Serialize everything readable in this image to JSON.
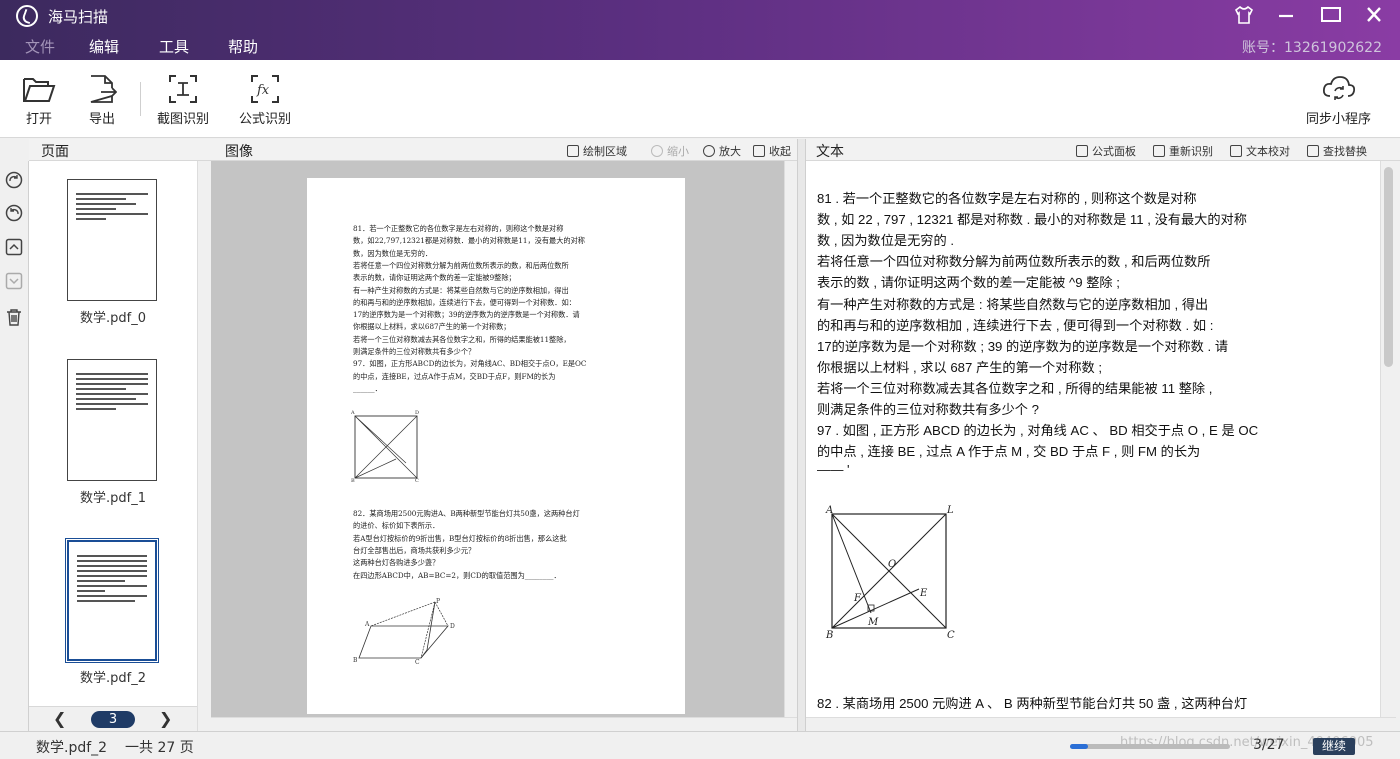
{
  "app": {
    "title": "海马扫描",
    "account": "账号：13261902622"
  },
  "menu": [
    "文件",
    "编辑",
    "工具",
    "帮助"
  ],
  "toolbar": {
    "open": "打开",
    "export": "导出",
    "screenshot_ocr": "截图识别",
    "formula_ocr": "公式识别",
    "sync": "同步小程序"
  },
  "pages_panel": {
    "title": "页面",
    "thumbnails": [
      "数学.pdf_0",
      "数学.pdf_1",
      "数学.pdf_2"
    ],
    "current_page": "3",
    "selected_index": 2
  },
  "image_panel": {
    "title": "图像",
    "actions": [
      "绘制区域",
      "缩小",
      "放大",
      "收起"
    ],
    "doc_lines": [
      "81．若一个正整数它的各位数字是左右对称的，则称这个数是对称",
      "数，如22,797,12321都是对称数．最小的对称数是11，没有最大的对称",
      "数，因为数位是无穷的．",
      "若将任意一个四位对称数分解为前两位数所表示的数，和后两位数所",
      "表示的数，请你证明这两个数的差一定能被9整除；",
      "有一种产生对称数的方式是：将某些自然数与它的逆序数相加，得出",
      "的和再与和的逆序数相加，连续进行下去，便可得到一个对称数．如：",
      "17的逆序数为是一个对称数；39的逆序数为的逆序数是一个对称数．请",
      "你根据以上材料，求以687产生的第一个对称数；",
      "若将一个三位对称数减去其各位数字之和，所得的结果能被11整除，",
      "则满足条件的三位对称数共有多少个？",
      "97．如图，正方形ABCD的边长为，对角线AC、BD相交于点O，E是OC",
      "的中点，连接BE，过点A作于点M，交BD于点F，则FM的长为",
      "______．"
    ],
    "doc_lines_b": [
      "82．某商场用2500元购进A、B两种新型节能台灯共50盏，这两种台灯",
      "的进价、标价如下表所示．",
      "若A型台灯按标价的9折出售，B型台灯按标价的8折出售，那么这批",
      "台灯全部售出后，商场共获利多少元？",
      "这两种台灯各购进多少盏？",
      "在四边形ABCD中，AB=BC=2，则CD的取值范围为________．"
    ],
    "fig_labels": [
      "A",
      "D",
      "O",
      "F",
      "E",
      "M",
      "B",
      "C"
    ],
    "fig2_labels": [
      "P",
      "A",
      "F",
      "D",
      "B",
      "C",
      "E"
    ]
  },
  "text_panel": {
    "title": "文本",
    "actions": [
      "公式面板",
      "重新识别",
      "文本校对",
      "查找替换"
    ],
    "lines": [
      "81 . 若一个正整数它的各位数字是左右对称的 , 则称这个数是对称",
      "数 , 如 22 , 797 , 12321 都是对称数 . 最小的对称数是 11 , 没有最大的对称",
      "数 , 因为数位是无穷的 .",
      "若将任意一个四位对称数分解为前两位数所表示的数 , 和后两位数所",
      "表示的数 , 请你证明这两个数的差一定能被 ^9 整除 ;",
      "有一种产生对称数的方式是 : 将某些自然数与它的逆序数相加 , 得出",
      "的和再与和的逆序数相加 , 连续进行下去 , 便可得到一个对称数 . 如 :",
      "17的逆序数为是一个对称数 ; 39 的逆序数为的逆序数是一个对称数 . 请",
      "你根据以上材料 , 求以 687 产生的第一个对称数 ;",
      "若将一个三位对称数减去其各位数字之和 , 所得的结果能被 11 整除 ,",
      "则满足条件的三位对称数共有多少个 ?",
      "97 . 如图 , 正方形 ABCD 的边长为 , 对角线 AC 、 BD 相交于点 O , E 是 OC",
      "的中点 , 连接 BE , 过点 A 作于点 M , 交 BD 于点 F , 则 FM 的长为",
      "—— '"
    ],
    "line_after_figure": "82 . 某商场用 2500 元购进 A 、 B 两种新型节能台灯共 50 盏 , 这两种台灯",
    "fig_labels": [
      "A",
      "L",
      "O",
      "F",
      "E",
      "M",
      "B",
      "C"
    ]
  },
  "status": {
    "file": "数学.pdf_2",
    "total": "一共 27 页",
    "progress_fraction": 0.11,
    "count": "3/27",
    "continue": "继续",
    "watermark": "https://blog.csdn.net/weixin_40406005"
  }
}
